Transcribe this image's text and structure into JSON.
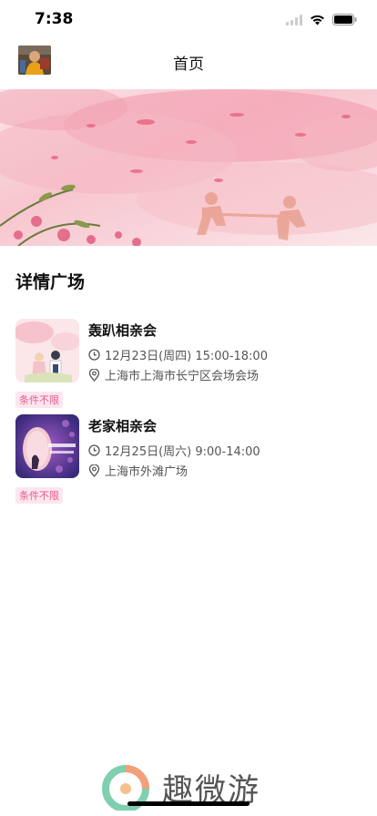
{
  "status_bar": {
    "time": "7:38"
  },
  "nav": {
    "title": "首页"
  },
  "section": {
    "title": "详情广场"
  },
  "events": [
    {
      "name": "轰趴相亲会",
      "datetime": "12月23日(周四) 15:00-18:00",
      "location": "上海市上海市长宁区会场会场",
      "tag": "条件不限"
    },
    {
      "name": "老家相亲会",
      "datetime": "12月25日(周六) 9:00-14:00",
      "location": "上海市外滩广场",
      "tag": "条件不限"
    }
  ],
  "watermark": {
    "text": "趣微游"
  },
  "colors": {
    "tag_text": "#e35b8a",
    "tag_bg": "#fde6ef",
    "banner_pink": "#f3a9b8"
  },
  "icons": [
    "clock-icon",
    "location-pin-icon",
    "wifi-icon",
    "signal-icon",
    "battery-icon"
  ]
}
